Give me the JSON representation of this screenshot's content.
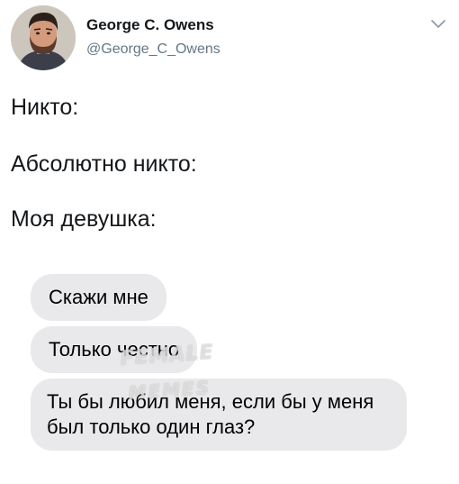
{
  "tweet": {
    "author": {
      "name": "George C. Owens",
      "handle": "@George_C_Owens"
    },
    "lines": [
      "Никто:",
      "Абсолютно никто:",
      "Моя девушка:"
    ],
    "messages": [
      "Скажи мне",
      "Только честно",
      "Ты бы любил меня, если бы у меня был только один глаз?"
    ],
    "watermark": {
      "line1": "FEMALE",
      "line2": "MEMES"
    },
    "icons": {
      "menu": "chevron-down-icon",
      "avatar": "avatar"
    },
    "colors": {
      "name": "#14171a",
      "handle": "#657786",
      "bubble": "#e9e9eb",
      "chevron": "#8899a6"
    }
  }
}
